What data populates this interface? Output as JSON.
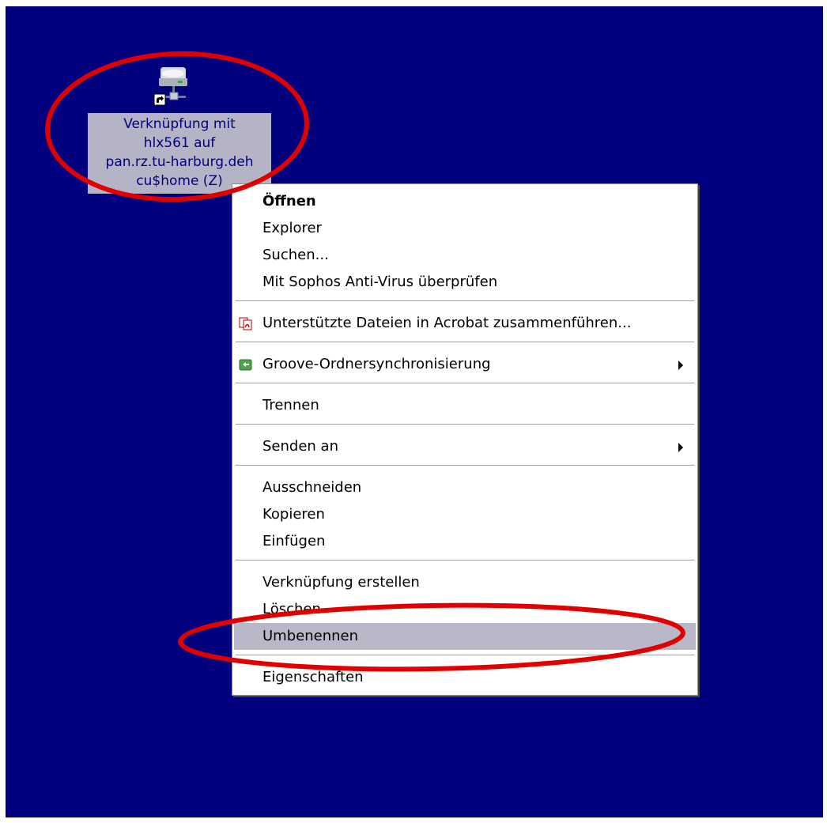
{
  "desktop": {
    "background_color": "#00007f",
    "icon": {
      "type": "network-drive-shortcut-icon",
      "label_lines": [
        "Verknüpfung mit",
        "hlx561 auf",
        "pan.rz.tu-harburg.deh",
        "cu$home (Z)"
      ]
    }
  },
  "context_menu": {
    "items": [
      {
        "label": "Öffnen",
        "bold": true
      },
      {
        "label": "Explorer"
      },
      {
        "label": "Suchen..."
      },
      {
        "label": "Mit Sophos Anti-Virus überprüfen"
      },
      {
        "label": "Unterstützte Dateien in Acrobat zusammenführen...",
        "icon": "acrobat-icon"
      },
      {
        "label": "Groove-Ordnersynchronisierung",
        "icon": "groove-icon",
        "submenu": true
      },
      {
        "label": "Trennen"
      },
      {
        "label": "Senden an",
        "submenu": true
      },
      {
        "label": "Ausschneiden"
      },
      {
        "label": "Kopieren"
      },
      {
        "label": "Einfügen"
      },
      {
        "label": "Verknüpfung erstellen"
      },
      {
        "label": "Löschen"
      },
      {
        "label": "Umbenennen",
        "selected": true
      },
      {
        "label": "Eigenschaften"
      }
    ]
  },
  "annotations": {
    "color": "#e00000"
  }
}
